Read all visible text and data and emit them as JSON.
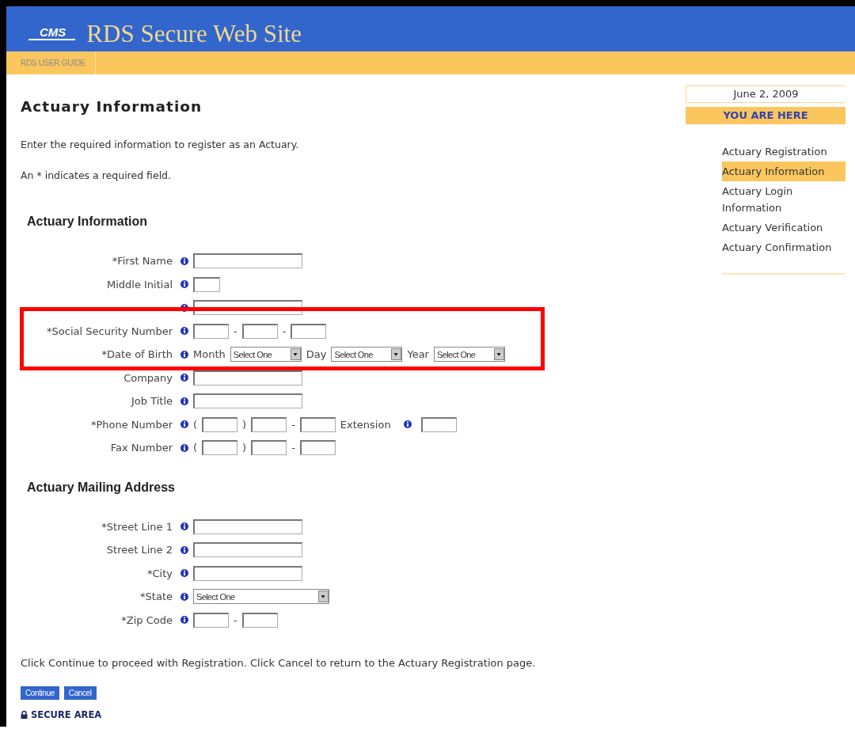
{
  "header": {
    "logo": "CMS",
    "title": "RDS Secure Web Site"
  },
  "nav": [
    {
      "label": "RDS USER GUIDE"
    }
  ],
  "page_title": "Actuary Information",
  "intro": "Enter the required information to register as an Actuary.",
  "required_note": "An * indicates a required field.",
  "sections": [
    {
      "title": "Actuary Information",
      "rows": [
        {
          "label": "*First Name",
          "parts": [
            {
              "kind": "field"
            }
          ]
        },
        {
          "label": "Middle Initial",
          "parts": [
            {
              "kind": "initial"
            }
          ]
        },
        {
          "parts": [
            {
              "kind": "field"
            }
          ]
        },
        {
          "label": "*Social Security Number",
          "parts": [
            {
              "kind": "box"
            },
            {
              "kind": "text",
              "text": "-"
            },
            {
              "kind": "box"
            },
            {
              "kind": "text",
              "text": "-"
            },
            {
              "kind": "box"
            }
          ]
        },
        {
          "label": "*Date of Birth",
          "parts": [
            {
              "kind": "text",
              "text": "Month"
            },
            {
              "kind": "dropdown",
              "value": "Select One"
            },
            {
              "kind": "text",
              "text": "Day"
            },
            {
              "kind": "dropdown",
              "value": "Select One"
            },
            {
              "kind": "text",
              "text": "Year"
            },
            {
              "kind": "dropdown",
              "value": "Select One"
            }
          ]
        },
        {
          "label": "Company",
          "parts": [
            {
              "kind": "field"
            }
          ]
        },
        {
          "label": "Job Title",
          "parts": [
            {
              "kind": "field"
            }
          ]
        },
        {
          "label": "*Phone Number",
          "parts": [
            {
              "kind": "text",
              "text": "("
            },
            {
              "kind": "box"
            },
            {
              "kind": "text",
              "text": ")"
            },
            {
              "kind": "box"
            },
            {
              "kind": "text",
              "text": "-"
            },
            {
              "kind": "box"
            },
            {
              "kind": "text",
              "text": "Extension"
            },
            {
              "kind": "info"
            },
            {
              "kind": "box"
            }
          ]
        },
        {
          "label": "Fax Number",
          "parts": [
            {
              "kind": "text",
              "text": "("
            },
            {
              "kind": "box"
            },
            {
              "kind": "text",
              "text": ")"
            },
            {
              "kind": "box"
            },
            {
              "kind": "text",
              "text": "-"
            },
            {
              "kind": "box"
            }
          ]
        }
      ]
    },
    {
      "title": "Actuary Mailing Address",
      "rows": [
        {
          "label": "*Street Line 1",
          "parts": [
            {
              "kind": "field"
            }
          ]
        },
        {
          "label": "Street Line 2",
          "parts": [
            {
              "kind": "field"
            }
          ]
        },
        {
          "label": "*City",
          "parts": [
            {
              "kind": "field"
            }
          ]
        },
        {
          "label": "*State",
          "parts": [
            {
              "kind": "list",
              "value": "Select One"
            }
          ]
        },
        {
          "label": "*Zip Code",
          "parts": [
            {
              "kind": "box"
            },
            {
              "kind": "text",
              "text": "-"
            },
            {
              "kind": "box"
            }
          ]
        }
      ]
    }
  ],
  "footer_note": "Click Continue to proceed with Registration. Click Cancel to return to the Actuary Registration page.",
  "buttons": [
    {
      "label": "Continue"
    },
    {
      "label": "Cancel"
    }
  ],
  "secure_label": "SECURE AREA",
  "sidebar": {
    "date": "June 2, 2009",
    "heading": "YOU ARE HERE",
    "steps": [
      {
        "label": "Actuary Registration",
        "selected": false
      },
      {
        "label": "Actuary Information",
        "selected": true
      },
      {
        "label": "Actuary Login Information",
        "selected": false
      },
      {
        "label": "Actuary Verification",
        "selected": false
      },
      {
        "label": "Actuary Confirmation",
        "selected": false
      }
    ]
  }
}
